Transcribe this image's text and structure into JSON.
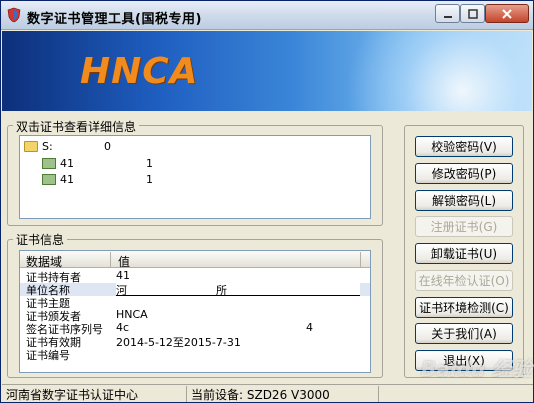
{
  "window": {
    "title": "数字证书管理工具(国税专用)"
  },
  "banner": {
    "logo_text": "HNCA"
  },
  "cert_tree": {
    "group_label": "双击证书查看详细信息",
    "root": {
      "label": "S:",
      "count": "0"
    },
    "items": [
      {
        "label": "41",
        "count": "1"
      },
      {
        "label": "41",
        "count": "1"
      }
    ]
  },
  "cert_info": {
    "group_label": "证书信息",
    "columns": [
      "数据域",
      "值"
    ],
    "rows": [
      {
        "key": "证书持有者",
        "value": "41",
        "extra": ""
      },
      {
        "key": "单位名称",
        "value": "河",
        "extra": "所"
      },
      {
        "key": "证书主题",
        "value": "",
        "extra": ""
      },
      {
        "key": "证书颁发者",
        "value": "HNCA",
        "extra": ""
      },
      {
        "key": "签名证书序列号",
        "value": "4c",
        "extra": "4"
      },
      {
        "key": "证书有效期",
        "value": "2014-5-12至2015-7-31",
        "extra": ""
      },
      {
        "key": "证书编号",
        "value": "",
        "extra": ""
      }
    ]
  },
  "buttons": {
    "verify": "校验密码(V)",
    "change": "修改密码(P)",
    "unlock": "解锁密码(L)",
    "register": "注册证书(G)",
    "uninstall": "卸载证书(U)",
    "online_check": "在线年检认证(O)",
    "env_check": "证书环境检测(C)",
    "about": "关于我们(A)",
    "exit": "退出(X)"
  },
  "status": {
    "org": "河南省数字证书认证中心",
    "device": "当前设备: SZD26 V3000"
  },
  "watermark": "Baidu 经验"
}
